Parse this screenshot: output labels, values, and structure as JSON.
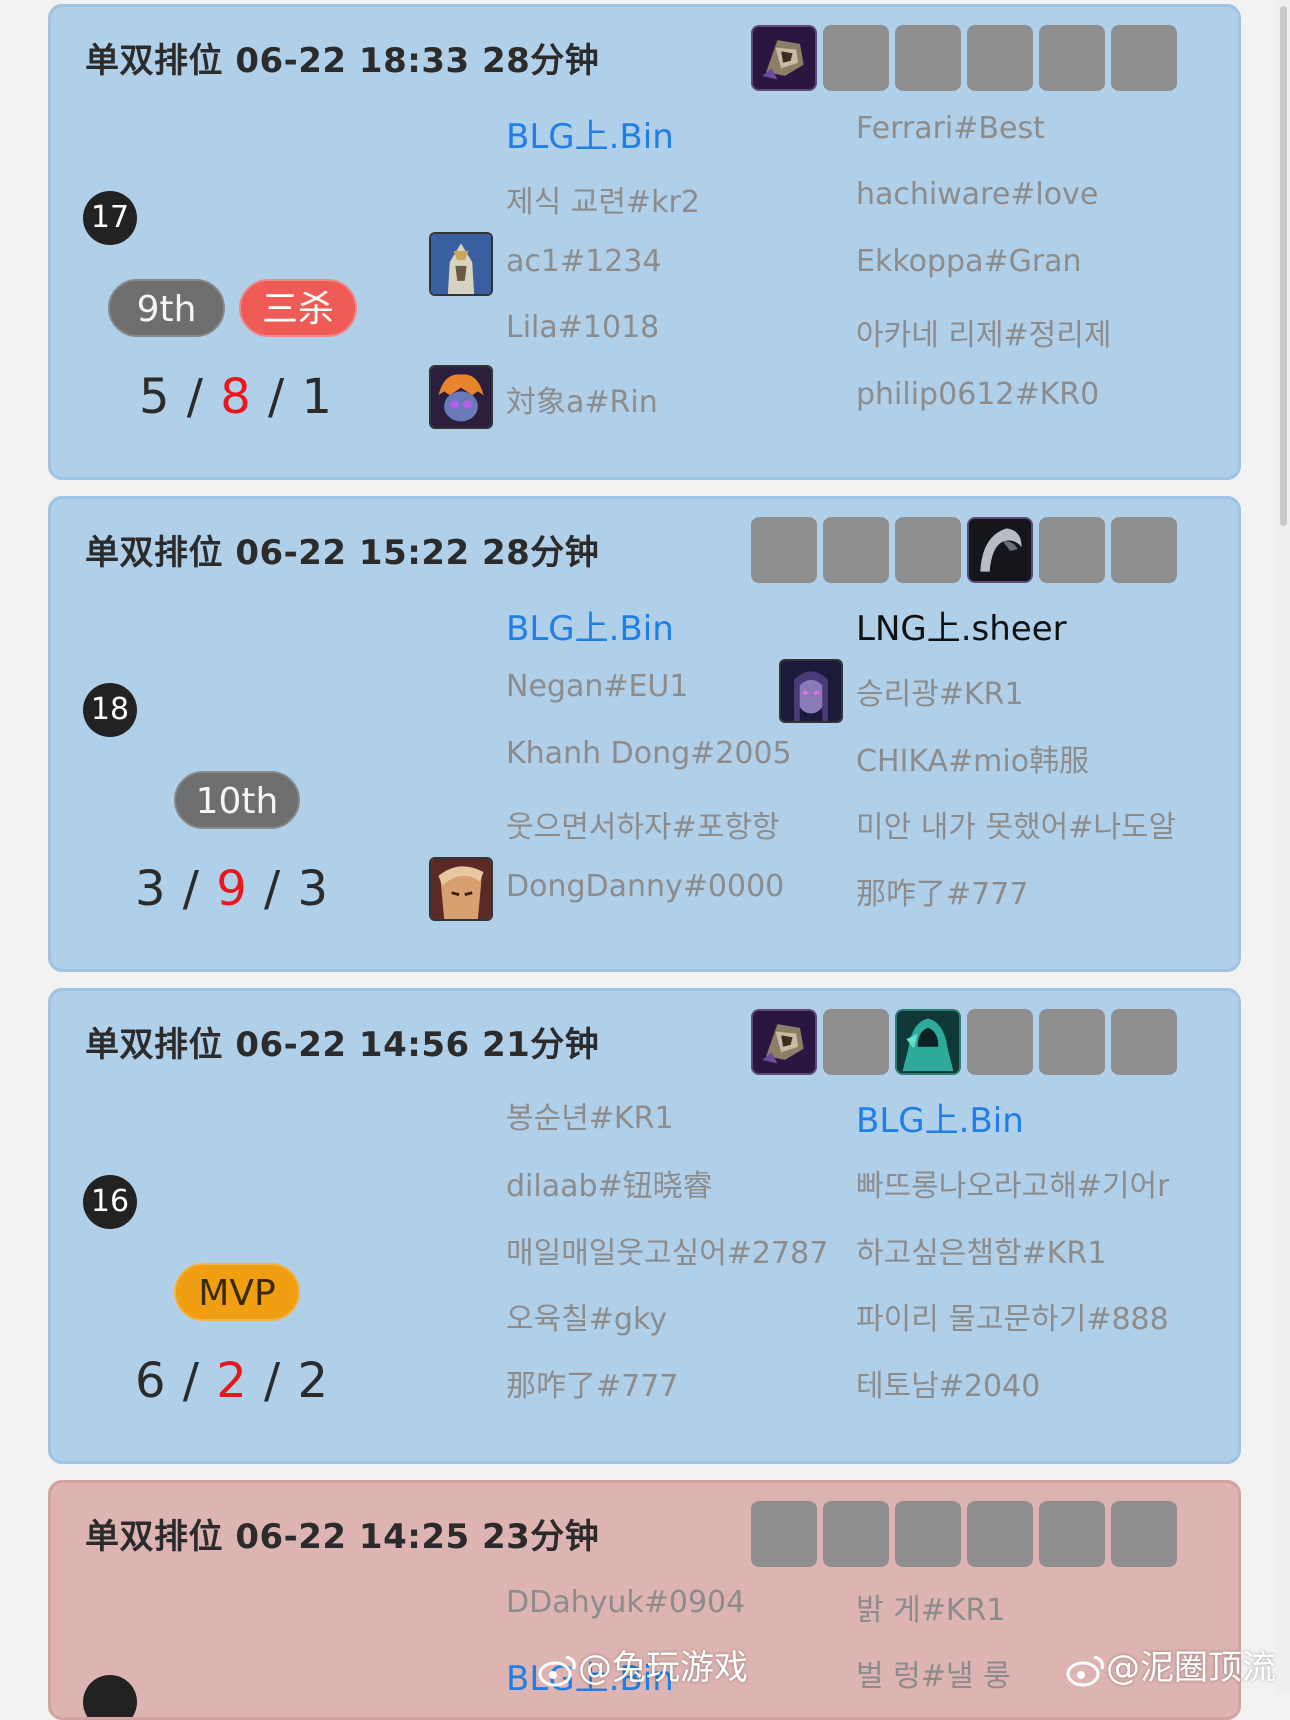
{
  "matches": [
    {
      "title": "单双排位 06-22 18:33 28分钟",
      "rank": "17",
      "place": "9th",
      "badge": "三杀",
      "kda": {
        "k": "5",
        "d": "8",
        "a": "1"
      },
      "blue_team": [
        "BLG上.Bin",
        "제식 교련#kr2",
        "ac1#1234",
        "Lila#1018",
        "対象a#Rin"
      ],
      "red_team": [
        "Ferrari#Best",
        "hachiware#love",
        "Ekkoppa#Gran",
        "아카네 리제#정리제",
        "philip0612#KR0"
      ],
      "items": [
        "helmet-item-icon",
        "",
        "",
        "",
        "",
        ""
      ]
    },
    {
      "title": "单双排位 06-22 15:22 28分钟",
      "rank": "18",
      "place": "10th",
      "kda": {
        "k": "3",
        "d": "9",
        "a": "3"
      },
      "blue_team": [
        "BLG上.Bin",
        "Negan#EU1",
        "Khanh Dong#2005",
        "웃으면서하자#포항항",
        "DongDanny#0000"
      ],
      "red_team": [
        "LNG上.sheer",
        "승리광#KR1",
        "CHIKA#mio韩服",
        "미안 내가 못했어#나도알",
        "那咋了#777"
      ],
      "items": [
        "",
        "",
        "",
        "scythe-item-icon",
        "",
        ""
      ]
    },
    {
      "title": "单双排位 06-22 14:56 21分钟",
      "rank": "16",
      "place": "MVP",
      "kda": {
        "k": "6",
        "d": "2",
        "a": "2"
      },
      "blue_team": [
        "봉순년#KR1",
        "dilaab#钮晓睿",
        "매일매일웃고싶어#2787",
        "오육칠#gky",
        "那咋了#777"
      ],
      "red_team": [
        "BLG上.Bin",
        "빠뜨롱나오라고해#기어r",
        "하고싶은챔함#KR1",
        "파이리 물고문하기#888",
        "테토남#2040"
      ],
      "items": [
        "helmet-item-icon",
        "",
        "hooded-figure-item-icon",
        "",
        "",
        ""
      ]
    },
    {
      "title": "单双排位 06-22 14:25 23分钟",
      "blue_team": [
        "DDahyuk#0904",
        "BLG上.Bin"
      ],
      "red_team": [
        "밝 게#KR1",
        "벌 렁#낼 룽"
      ],
      "items": [
        "",
        "",
        "",
        "",
        "",
        ""
      ]
    }
  ],
  "watermarks": [
    "@兔玩游戏",
    "@泥圈顶流"
  ],
  "colors": {
    "card_win": "#b0cfe9",
    "card_loss": "#ddb4b1",
    "self_name": "#1f7fe6",
    "deaths": "#e8171b",
    "mvp": "#ef9f11",
    "multikill": "#ef5b57"
  }
}
